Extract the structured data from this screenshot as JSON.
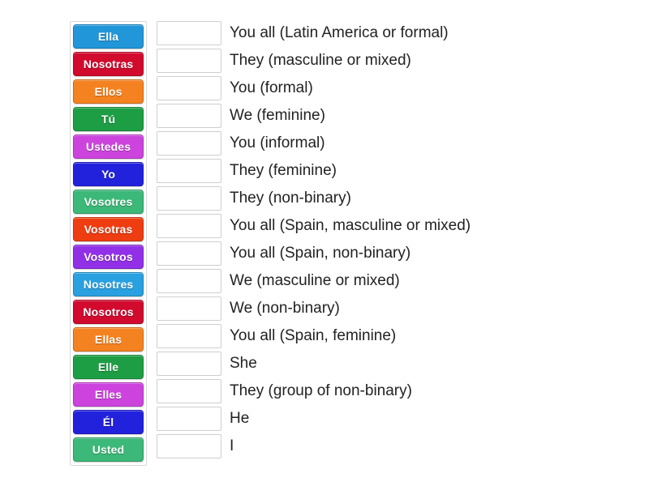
{
  "activity": {
    "type": "match-up-drag-and-drop",
    "tile_count": 16,
    "answer_count": 16
  },
  "tiles": [
    {
      "label": "Ella",
      "color": "#2196d8"
    },
    {
      "label": "Nosotras",
      "color": "#d10a2e"
    },
    {
      "label": "Ellos",
      "color": "#f58220"
    },
    {
      "label": "Tú",
      "color": "#1d9e44"
    },
    {
      "label": "Ustedes",
      "color": "#cc44dd"
    },
    {
      "label": "Yo",
      "color": "#2222dd"
    },
    {
      "label": "Vosotres",
      "color": "#3cb878"
    },
    {
      "label": "Vosotras",
      "color": "#ee3d11"
    },
    {
      "label": "Vosotros",
      "color": "#9230e8"
    },
    {
      "label": "Nosotres",
      "color": "#29a0e0"
    },
    {
      "label": "Nosotros",
      "color": "#d10a2e"
    },
    {
      "label": "Ellas",
      "color": "#f58220"
    },
    {
      "label": "Elle",
      "color": "#1d9e44"
    },
    {
      "label": "Elles",
      "color": "#cc44dd"
    },
    {
      "label": "Él",
      "color": "#2222dd"
    },
    {
      "label": "Usted",
      "color": "#3cb878"
    }
  ],
  "answers": [
    {
      "text": "You all (Latin America or formal)",
      "value": ""
    },
    {
      "text": "They (masculine or mixed)",
      "value": ""
    },
    {
      "text": "You (formal)",
      "value": ""
    },
    {
      "text": "We (feminine)",
      "value": ""
    },
    {
      "text": "You (informal)",
      "value": ""
    },
    {
      "text": "They (feminine)",
      "value": ""
    },
    {
      "text": "They (non-binary)",
      "value": ""
    },
    {
      "text": "You all (Spain, masculine or mixed)",
      "value": ""
    },
    {
      "text": "You all (Spain, non-binary)",
      "value": ""
    },
    {
      "text": "We (masculine or mixed)",
      "value": ""
    },
    {
      "text": "We (non-binary)",
      "value": ""
    },
    {
      "text": "You all (Spain, feminine)",
      "value": ""
    },
    {
      "text": "She",
      "value": ""
    },
    {
      "text": "They (group of non-binary)",
      "value": ""
    },
    {
      "text": "He",
      "value": ""
    },
    {
      "text": "I",
      "value": ""
    }
  ],
  "colors": {
    "page_background": "#ffffff",
    "text": "#222222",
    "tile_text": "#ffffff",
    "box_border": "#cfcfcf",
    "column_border": "#d8d8d8"
  }
}
